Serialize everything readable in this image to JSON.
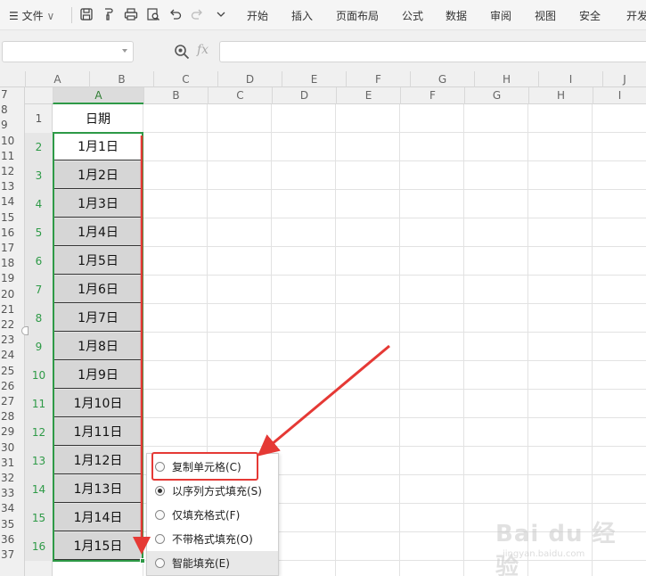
{
  "ribbon": {
    "menu_label": "文件",
    "tabs": [
      "开始",
      "插入",
      "页面布局",
      "公式",
      "数据",
      "审阅",
      "视图",
      "安全",
      "开发"
    ]
  },
  "formula_bar": {
    "name_box_value": "",
    "fx_label": "fx",
    "formula_value": ""
  },
  "outer_columns": [
    "A",
    "B",
    "C",
    "D",
    "E",
    "F",
    "G",
    "H",
    "I",
    "J"
  ],
  "outer_rows": [
    "7",
    "8",
    "9",
    "10",
    "11",
    "12",
    "13",
    "14",
    "15",
    "16",
    "17",
    "18",
    "19",
    "20",
    "21",
    "22",
    "23",
    "24",
    "25",
    "26",
    "27",
    "28",
    "29",
    "30",
    "31",
    "32",
    "33",
    "34",
    "35",
    "36",
    "37"
  ],
  "inner_columns": [
    "A",
    "B",
    "C",
    "D",
    "E",
    "F",
    "G",
    "H",
    "I"
  ],
  "inner_rows": [
    "1",
    "2",
    "3",
    "4",
    "5",
    "6",
    "7",
    "8",
    "9",
    "10",
    "11",
    "12",
    "13",
    "14",
    "15",
    "16"
  ],
  "column_a": {
    "header": "日期",
    "values": [
      "1月1日",
      "1月2日",
      "1月3日",
      "1月4日",
      "1月5日",
      "1月6日",
      "1月7日",
      "1月8日",
      "1月9日",
      "1月10日",
      "1月11日",
      "1月12日",
      "1月13日",
      "1月14日",
      "1月15日"
    ]
  },
  "autofill_menu": {
    "options": [
      {
        "label": "复制单元格(C)",
        "checked": false
      },
      {
        "label": "以序列方式填充(S)",
        "checked": true
      },
      {
        "label": "仅填充格式(F)",
        "checked": false
      },
      {
        "label": "不带格式填充(O)",
        "checked": false
      },
      {
        "label": "智能填充(E)",
        "checked": false
      }
    ]
  },
  "watermark": {
    "brand": "Bai du 经验",
    "url": "jingyan.baidu.com"
  },
  "colors": {
    "selection_green": "#2e9a47",
    "annotation_red": "#e53935",
    "selected_fill": "#d6d6d6"
  }
}
